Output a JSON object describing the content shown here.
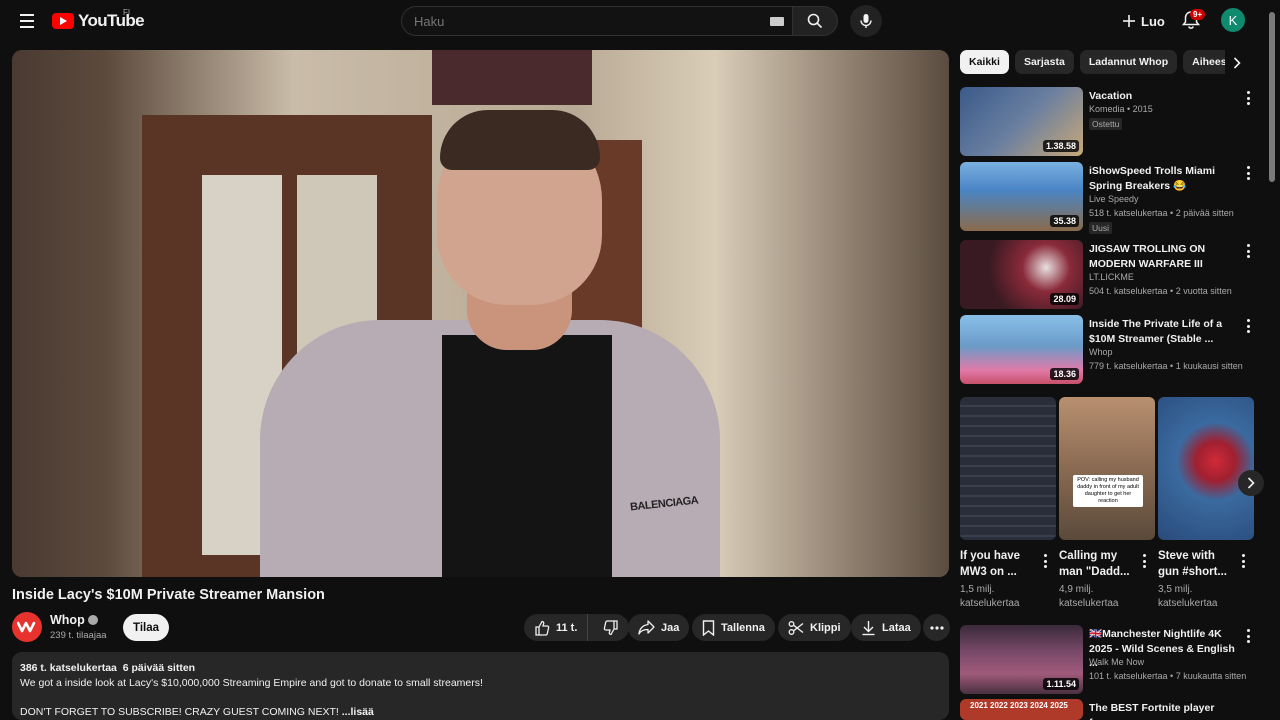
{
  "header": {
    "logo_text": "YouTube",
    "logo_country": "FI",
    "search_placeholder": "Haku",
    "create_label": "Luo",
    "notifications_badge": "9+",
    "avatar_letter": "K",
    "avatar_color": "#0e8a6e"
  },
  "video": {
    "title": "Inside Lacy's $10M Private Streamer Mansion",
    "shirt_text": "BALENCIAGA"
  },
  "channel": {
    "name": "Whop",
    "subscribers": "239 t. tilaajaa",
    "subscribe_label": "Tilaa"
  },
  "actions": {
    "likes": "11 t.",
    "share": "Jaa",
    "save": "Tallenna",
    "clip": "Klippi",
    "download": "Lataa"
  },
  "description": {
    "meta": "386 t. katselukertaa  6 päivää sitten",
    "line1": "We got a inside look at Lacy's $10,000,000 Streaming Empire and got to donate to small streamers!",
    "line2": "DON'T FORGET TO SUBSCRIBE! CRAZY GUEST COMING NEXT!",
    "more": "...lisää"
  },
  "chips": [
    {
      "label": "Kaikki",
      "active": true
    },
    {
      "label": "Sarjasta",
      "active": false
    },
    {
      "label": "Ladannut Whop",
      "active": false
    },
    {
      "label": "Aiheeseen liittyvät",
      "active": false
    }
  ],
  "recommendations": [
    {
      "title_line1": "Vacation",
      "title_line2": "",
      "channel": "Komedia • 2015",
      "meta": "",
      "badge": "Ostettu",
      "duration": "1.38.58",
      "thumb": "#6a7fa0"
    },
    {
      "title_line1": "iShowSpeed Trolls Miami",
      "title_line2": "Spring Breakers 😂",
      "channel": "Live Speedy",
      "meta": "518 t. katselukertaa • 2 päivää sitten",
      "badge": "Uusi",
      "duration": "35.38",
      "thumb": "#4a86c6"
    },
    {
      "title_line1": "JIGSAW TROLLING ON",
      "title_line2": "MODERN WARFARE III",
      "channel": "LT.LICKME",
      "meta": "504 t. katselukertaa • 2 vuotta sitten",
      "badge": "",
      "duration": "28.09",
      "thumb": "#3a1a22"
    },
    {
      "title_line1": "Inside The Private Life of a",
      "title_line2": "$10M Streamer (Stable ...",
      "channel": "Whop",
      "meta": "779 t. katselukertaa • 1 kuukausi sitten",
      "badge": "",
      "duration": "18.36",
      "thumb": "#6b9bc8"
    }
  ],
  "shorts": [
    {
      "title_line1": "If you have",
      "title_line2": "MW3 on ...",
      "views_line1": "1,5 milj.",
      "views_line2": "katselukertaa",
      "thumb": "#2a2e3a"
    },
    {
      "title_line1": "Calling my",
      "title_line2": "man \"Dadd...",
      "views_line1": "4,9 milj.",
      "views_line2": "katselukertaa",
      "thumb": "#8a6a52",
      "caption": "POV: calling my husband daddy in front of my adult daughter to get her reaction"
    },
    {
      "title_line1": "Steve with",
      "title_line2": "gun #short...",
      "views_line1": "3,5 milj.",
      "views_line2": "katselukertaa",
      "thumb": "#3a6aa0"
    }
  ],
  "recommendation_bottom": [
    {
      "title_line1": "🇬🇧Manchester Nightlife 4K",
      "title_line2": "2025 - Wild Scenes & English ...",
      "channel": "Walk Me Now",
      "meta": "101 t. katselukertaa • 7 kuukautta sitten",
      "duration": "1.11.54",
      "thumb": "#7a4a6a"
    },
    {
      "title_line1": "The BEST Fortnite player from",
      "title_line2": "",
      "channel": "",
      "meta": "",
      "duration": "",
      "thumb": "#b03a2a",
      "thumb_text": "2021 2022 2023 2024 2025"
    }
  ]
}
